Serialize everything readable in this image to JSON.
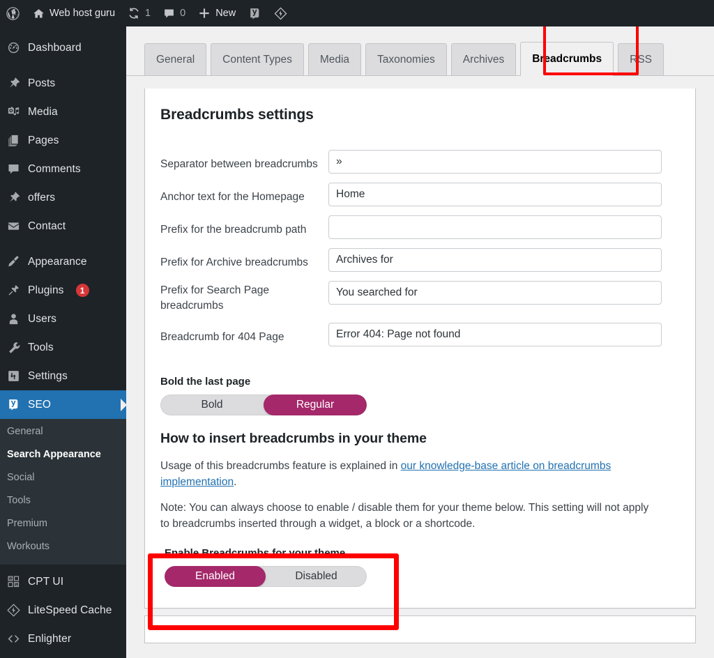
{
  "adminbar": {
    "wp_logo_icon": "wordpress-logo-icon",
    "site_icon": "home-icon",
    "site_name": "Web host guru",
    "updates_icon": "update-arrows-icon",
    "updates_count": "1",
    "comments_icon": "comment-bubble-icon",
    "comments_count": "0",
    "new_icon": "plus-icon",
    "new_label": "New",
    "yoast_icon": "yoast-seo-icon",
    "litespeed_icon": "litespeed-diamond-icon"
  },
  "sidebar": {
    "items": [
      {
        "label": "Dashboard",
        "icon": "dashboard-gauge-icon",
        "current": false
      },
      {
        "label": "Posts",
        "icon": "pin-icon",
        "current": false
      },
      {
        "label": "Media",
        "icon": "media-camera-music-icon",
        "current": false
      },
      {
        "label": "Pages",
        "icon": "pages-stack-icon",
        "current": false
      },
      {
        "label": "Comments",
        "icon": "comment-bubble-icon",
        "current": false
      },
      {
        "label": "offers",
        "icon": "pin-icon",
        "current": false
      },
      {
        "label": "Contact",
        "icon": "envelope-icon",
        "current": false
      },
      {
        "label": "Appearance",
        "icon": "paint-brush-icon",
        "current": false
      },
      {
        "label": "Plugins",
        "icon": "plug-icon",
        "badge": "1",
        "current": false
      },
      {
        "label": "Users",
        "icon": "user-icon",
        "current": false
      },
      {
        "label": "Tools",
        "icon": "wrench-icon",
        "current": false
      },
      {
        "label": "Settings",
        "icon": "settings-sliders-icon",
        "current": false
      },
      {
        "label": "SEO",
        "icon": "yoast-seo-icon",
        "current": true
      }
    ],
    "submenu": [
      {
        "label": "General",
        "current": false
      },
      {
        "label": "Search Appearance",
        "current": true
      },
      {
        "label": "Social",
        "current": false
      },
      {
        "label": "Tools",
        "current": false
      },
      {
        "label": "Premium",
        "current": false
      },
      {
        "label": "Workouts",
        "current": false
      }
    ],
    "lower_items": [
      {
        "label": "CPT UI",
        "icon": "cpt-ui-blocks-icon"
      },
      {
        "label": "LiteSpeed Cache",
        "icon": "litespeed-diamond-icon"
      },
      {
        "label": "Enlighter",
        "icon": "enlighter-code-icon"
      }
    ]
  },
  "tabs": [
    {
      "label": "General",
      "active": false,
      "highlighted": false
    },
    {
      "label": "Content Types",
      "active": false,
      "highlighted": false
    },
    {
      "label": "Media",
      "active": false,
      "highlighted": false
    },
    {
      "label": "Taxonomies",
      "active": false,
      "highlighted": false
    },
    {
      "label": "Archives",
      "active": false,
      "highlighted": false
    },
    {
      "label": "Breadcrumbs",
      "active": true,
      "highlighted": true
    },
    {
      "label": "RSS",
      "active": false,
      "highlighted": false
    }
  ],
  "main": {
    "heading": "Breadcrumbs settings",
    "fields": [
      {
        "label": "Separator between breadcrumbs",
        "value": "»",
        "placeholder": "",
        "two_line": false
      },
      {
        "label": "Anchor text for the Homepage",
        "value": "Home",
        "placeholder": "",
        "two_line": false
      },
      {
        "label": "Prefix for the breadcrumb path",
        "value": "",
        "placeholder": "",
        "two_line": false
      },
      {
        "label": "Prefix for Archive breadcrumbs",
        "value": "Archives for",
        "placeholder": "",
        "two_line": false
      },
      {
        "label": "Prefix for Search Page breadcrumbs",
        "value": "You searched for",
        "placeholder": "",
        "two_line": true
      },
      {
        "label": "Breadcrumb for 404 Page",
        "value": "Error 404: Page not found",
        "placeholder": "",
        "two_line": false
      }
    ],
    "bold_last_page": {
      "label": "Bold the last page",
      "options": [
        {
          "label": "Bold",
          "selected": false
        },
        {
          "label": "Regular",
          "selected": true
        }
      ]
    },
    "insert_heading": "How to insert breadcrumbs in your theme",
    "usage_prefix": "Usage of this breadcrumbs feature is explained in ",
    "usage_link": "our knowledge-base article on breadcrumbs implementation",
    "usage_suffix": ".",
    "note": "Note: You can always choose to enable / disable them for your theme below. This setting will not apply to breadcrumbs inserted through a widget, a block or a shortcode.",
    "enable_breadcrumbs": {
      "label": "Enable Breadcrumbs for your theme",
      "options": [
        {
          "label": "Enabled",
          "selected": true
        },
        {
          "label": "Disabled",
          "selected": false
        }
      ]
    }
  },
  "colors": {
    "accent_magenta": "#a4286a",
    "admin_blue": "#2271b1",
    "highlight_red": "#ff0000",
    "sidebar_bg": "#1d2327",
    "submenu_bg": "#2c3338",
    "badge_red": "#d63638"
  }
}
